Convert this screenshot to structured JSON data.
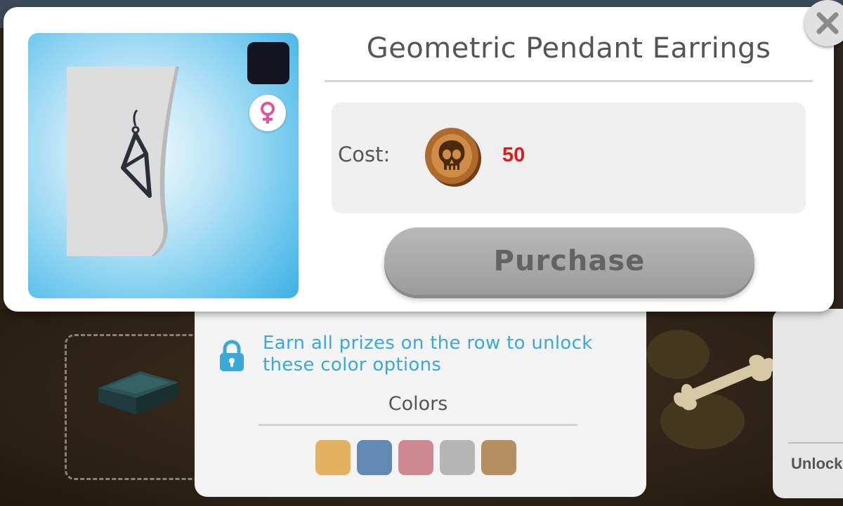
{
  "item": {
    "title": "Geometric Pendant Earrings",
    "gender_icon": "female-icon",
    "selected_color": "#12151f"
  },
  "cost": {
    "label": "Cost:",
    "currency_icon": "skull-coin-icon",
    "value": "50"
  },
  "purchase": {
    "label": "Purchase",
    "enabled": false
  },
  "close": {
    "icon": "close-icon"
  },
  "colors_panel": {
    "lock_icon": "lock-icon",
    "unlock_message": "Earn all prizes on the row to unlock these color options",
    "title": "Colors",
    "swatches": [
      "#e2b261",
      "#6189b2",
      "#cd8890",
      "#b5b5b5",
      "#b48f5f"
    ]
  },
  "background": {
    "side_card_label": "Unlock"
  },
  "colors": {
    "accent_text": "#3ba8d7",
    "cost_value": "#e01b1b",
    "button_disabled": "#a9a9a9"
  }
}
